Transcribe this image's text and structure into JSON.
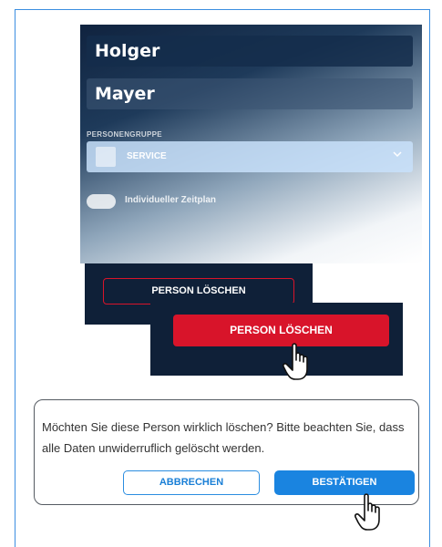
{
  "form": {
    "first_name": "Holger",
    "last_name": "Mayer",
    "group_label": "PERSONENGRUPPE",
    "group_value": "SERVICE",
    "group_chevron": "chevron-down-icon",
    "schedule_label": "Individueller Zeitplan",
    "schedule_enabled": false
  },
  "delete": {
    "outline_label": "PERSON LÖSCHEN",
    "filled_label": "PERSON LÖSCHEN",
    "accent": "#d8142a"
  },
  "dialog": {
    "message": "Möchten Sie diese Person wirklich löschen? Bitte beachten Sie, dass alle Daten unwiderruflich gelöscht werden.",
    "cancel_label": "ABBRECHEN",
    "confirm_label": "BESTÄTIGEN",
    "accent": "#1a84e0"
  },
  "colors": {
    "panel_dark": "#0f2038",
    "frame_border": "#3b8ee0"
  }
}
